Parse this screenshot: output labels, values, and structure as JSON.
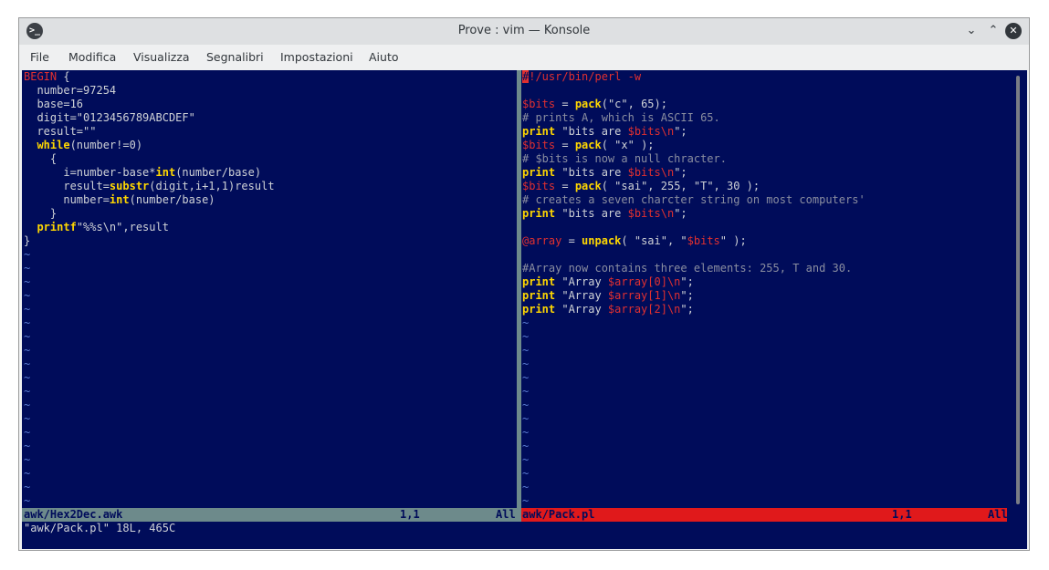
{
  "window": {
    "title": "Prove : vim — Konsole",
    "app_icon": ">_"
  },
  "menu": [
    "File",
    "Modifica",
    "Visualizza",
    "Segnalibri",
    "Impostazioni",
    "Aiuto"
  ],
  "left_pane": {
    "lines": [
      "BEGIN {",
      "  number=97254",
      "  base=16",
      "  digit=\"0123456789ABCDEF\"",
      "  result=\"\"",
      "  while(number!=0)",
      "    {",
      "      i=number-base*int(number/base)",
      "      result=substr(digit,i+1,1)result",
      "      number=int(number/base)",
      "    }",
      "  printf\"%%s\\n\",result",
      "}"
    ],
    "filename": "awk/Hex2Dec.awk",
    "position": "1,1",
    "scroll": "All"
  },
  "right_pane": {
    "lines": [
      "#!/usr/bin/perl -w",
      "",
      "$bits = pack(\"c\", 65);",
      "# prints A, which is ASCII 65.",
      "print \"bits are $bits\\n\";",
      "$bits = pack( \"x\" );",
      "# $bits is now a null chracter.",
      "print \"bits are $bits\\n\";",
      "$bits = pack( \"sai\", 255, \"T\", 30 );",
      "# creates a seven charcter string on most computers'",
      "print \"bits are $bits\\n\";",
      "",
      "@array = unpack( \"sai\", \"$bits\" );",
      "",
      "#Array now contains three elements: 255, T and 30.",
      "print \"Array $array[0]\\n\";",
      "print \"Array $array[1]\\n\";",
      "print \"Array $array[2]\\n\";"
    ],
    "filename": "awk/Pack.pl",
    "position": "1,1",
    "scroll": "All"
  },
  "tilde": "~",
  "cmdline": "\"awk/Pack.pl\" 18L, 465C",
  "colors": {
    "background": "#000c5a",
    "keyword": "#ffd700",
    "red": "#e03030",
    "comment": "#8a8ea0",
    "status_inactive": "#6d8a8b",
    "status_active": "#e0191b"
  }
}
